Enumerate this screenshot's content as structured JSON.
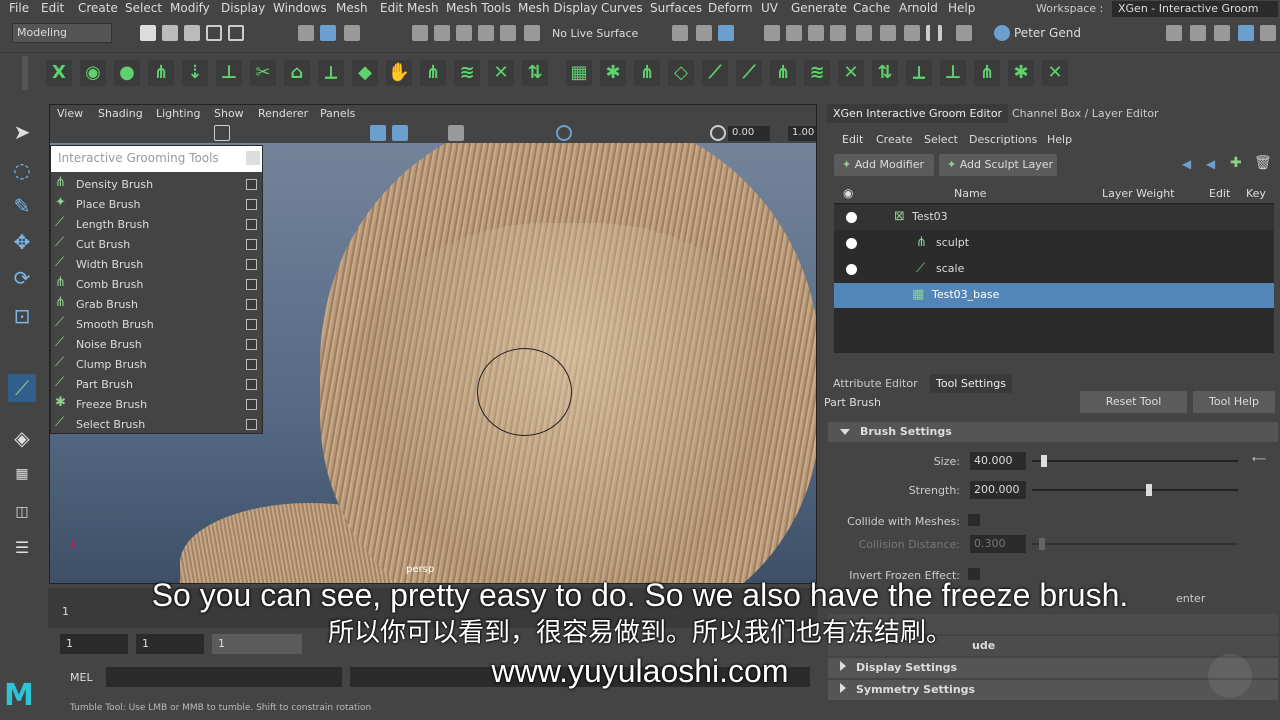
{
  "menubar": {
    "items": [
      "File",
      "Edit",
      "Create",
      "Select",
      "Modify",
      "Display",
      "Windows",
      "Mesh",
      "Edit Mesh",
      "Mesh Tools",
      "Mesh Display",
      "Curves",
      "Surfaces",
      "Deform",
      "UV",
      "Generate",
      "Cache",
      "Arnold",
      "Help"
    ],
    "workspace_label": "Workspace :",
    "workspace_value": "XGen - Interactive Groom"
  },
  "status_line": {
    "mode": "Modeling",
    "live_surface": "No Live Surface",
    "user": "Peter Gend"
  },
  "viewport": {
    "menu": [
      "View",
      "Shading",
      "Lighting",
      "Show",
      "Renderer",
      "Panels"
    ],
    "exposure": "0.00",
    "gamma": "1.00",
    "camera_label": "persp"
  },
  "grooming_tools": {
    "title": "Interactive Grooming Tools",
    "brushes": [
      "Density Brush",
      "Place Brush",
      "Length Brush",
      "Cut Brush",
      "Width Brush",
      "Comb Brush",
      "Grab Brush",
      "Smooth Brush",
      "Noise Brush",
      "Clump Brush",
      "Part Brush",
      "Freeze Brush",
      "Select Brush"
    ]
  },
  "timeline": {
    "current": "1",
    "start": "1",
    "range_start": "1",
    "range_inner": "1"
  },
  "command_line": {
    "lang": "MEL"
  },
  "help_line": "Tumble Tool: Use LMB or MMB to tumble. Shift to constrain rotation",
  "xgen_editor": {
    "tabs": [
      "XGen Interactive Groom Editor",
      "Channel Box / Layer Editor"
    ],
    "menu": [
      "Edit",
      "Create",
      "Select",
      "Descriptions",
      "Help"
    ],
    "add_modifier": "Add Modifier",
    "add_sculpt_layer": "Add Sculpt Layer",
    "columns": [
      "Name",
      "Layer Weight",
      "Edit",
      "Key"
    ],
    "rows": [
      {
        "name": "Test03"
      },
      {
        "name": "sculpt"
      },
      {
        "name": "scale"
      },
      {
        "name": "Test03_base"
      }
    ]
  },
  "tool_settings": {
    "tabs": [
      "Attribute Editor",
      "Tool Settings"
    ],
    "tool_name": "Part Brush",
    "reset_tool": "Reset Tool",
    "tool_help": "Tool Help",
    "brush_settings": "Brush Settings",
    "size_label": "Size:",
    "size_value": "40.000",
    "strength_label": "Strength:",
    "strength_value": "200.000",
    "collide_label": "Collide with Meshes:",
    "collision_distance_label": "Collision Distance:",
    "collision_distance_value": "0.300",
    "invert_frozen_label": "Invert Frozen Effect:",
    "center_fragment": "enter",
    "include_fragment": "ude",
    "display_settings": "Display Settings",
    "symmetry_settings": "Symmetry Settings"
  },
  "subtitles": {
    "english": "So you can see, pretty easy to do. So we also have the freeze brush.",
    "chinese": "所以你可以看到，很容易做到。所以我们也有冻结刷。",
    "url": "www.yuyulaoshi.com"
  },
  "colors": {
    "selection": "#5286b8",
    "shelf_green": "#5fd16d",
    "maya_logo": "#2ec4d6"
  }
}
